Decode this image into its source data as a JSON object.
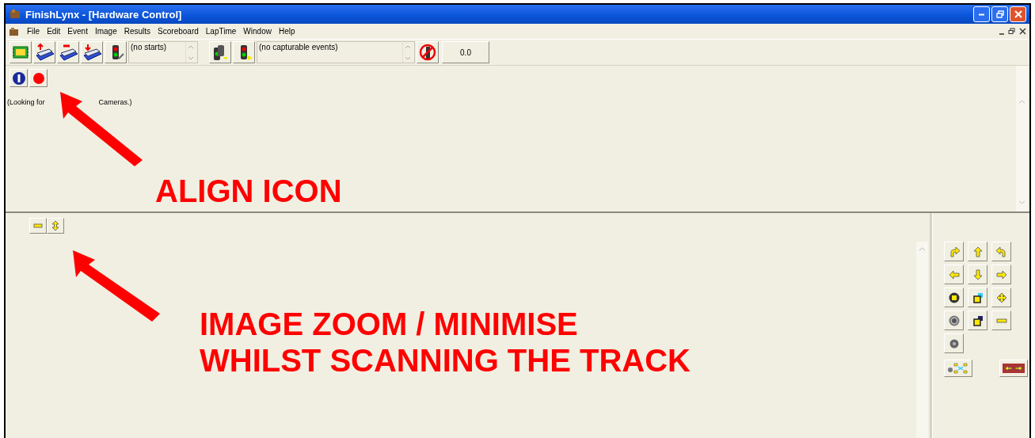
{
  "window": {
    "title": "FinishLynx - [Hardware Control]"
  },
  "menu": [
    "File",
    "Edit",
    "Event",
    "Image",
    "Results",
    "Scoreboard",
    "LapTime",
    "Window",
    "Help"
  ],
  "toolbar": {
    "starts_field": {
      "value": "(no starts)"
    },
    "events_field": {
      "value": "(no capturable events)"
    },
    "time_button": "0.0"
  },
  "hardware_pane": {
    "status_parts": [
      "(Looking for",
      "Cameras.)"
    ]
  },
  "annotations": [
    {
      "lines": [
        "ALIGN ICON"
      ]
    },
    {
      "lines": [
        "IMAGE ZOOM / MINIMISE",
        "WHILST SCANNING THE TRACK"
      ]
    }
  ]
}
